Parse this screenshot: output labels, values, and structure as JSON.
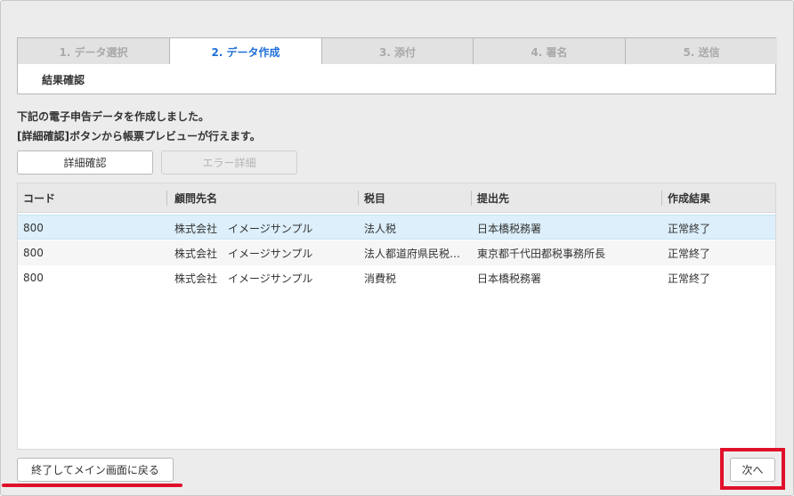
{
  "steps": [
    {
      "label": "1. データ選択",
      "active": false
    },
    {
      "label": "2. データ作成",
      "active": true
    },
    {
      "label": "3. 添付",
      "active": false
    },
    {
      "label": "4. 署名",
      "active": false
    },
    {
      "label": "5. 送信",
      "active": false
    }
  ],
  "panel": {
    "title": "結果確認"
  },
  "messages": {
    "line1": "下記の電子申告データを作成しました。",
    "line2": "[詳細確認]ボタンから帳票プレビューが行えます。"
  },
  "buttons": {
    "detail": "詳細確認",
    "error_detail": "エラー詳細",
    "back": "終了してメイン画面に戻る",
    "next": "次へ"
  },
  "table": {
    "headers": [
      "コード",
      "顧問先名",
      "税目",
      "提出先",
      "作成結果"
    ],
    "rows": [
      [
        "800",
        "株式会社　イメージサンプル",
        "法人税",
        "日本橋税務署",
        "正常終了"
      ],
      [
        "800",
        "株式会社　イメージサンプル",
        "法人都道府県民税…",
        "東京都千代田都税事務所長",
        "正常終了"
      ],
      [
        "800",
        "株式会社　イメージサンプル",
        "消費税",
        "日本橋税務署",
        "正常終了"
      ]
    ],
    "selected_row": 0
  },
  "colors": {
    "accent": "#1e6fd9",
    "highlight": "#e0102a",
    "selected_row": "#dceffa"
  }
}
